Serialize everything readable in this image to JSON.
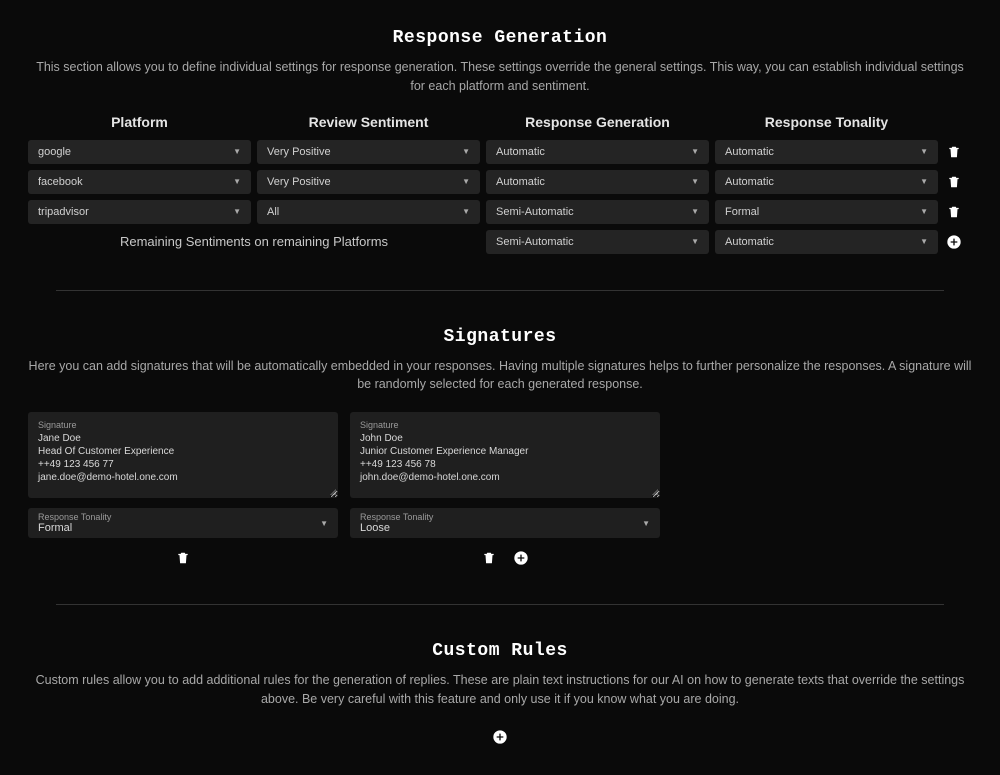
{
  "responseGeneration": {
    "title": "Response Generation",
    "description": "This section allows you to define individual settings for response generation. These settings override the general settings. This way, you can establish individual settings for each platform and sentiment.",
    "columns": {
      "platform": "Platform",
      "sentiment": "Review Sentiment",
      "generation": "Response Generation",
      "tonality": "Response Tonality"
    },
    "rows": [
      {
        "platform": "google",
        "sentiment": "Very Positive",
        "generation": "Automatic",
        "tonality": "Automatic"
      },
      {
        "platform": "facebook",
        "sentiment": "Very Positive",
        "generation": "Automatic",
        "tonality": "Automatic"
      },
      {
        "platform": "tripadvisor",
        "sentiment": "All",
        "generation": "Semi-Automatic",
        "tonality": "Formal"
      }
    ],
    "remaining": {
      "label": "Remaining Sentiments on remaining Platforms",
      "generation": "Semi-Automatic",
      "tonality": "Automatic"
    }
  },
  "signatures": {
    "title": "Signatures",
    "description": "Here you can add signatures that will be automatically embedded in your responses. Having multiple signatures helps to further personalize the responses. A signature will be randomly selected for each generated response.",
    "fieldLabel": "Signature",
    "tonalityLabel": "Response Tonality",
    "items": [
      {
        "body": "Jane Doe\nHead Of Customer Experience\n++49 123 456 77\njane.doe@demo-hotel.one.com",
        "tonality": "Formal"
      },
      {
        "body": "John Doe\nJunior Customer Experience Manager\n++49 123 456 78\njohn.doe@demo-hotel.one.com",
        "tonality": "Loose"
      }
    ]
  },
  "customRules": {
    "title": "Custom Rules",
    "description": "Custom rules allow you to add additional rules for the generation of replies. These are plain text instructions for our AI on how to generate texts that override the settings above. Be very careful with this feature and only use it if you know what you are doing."
  }
}
